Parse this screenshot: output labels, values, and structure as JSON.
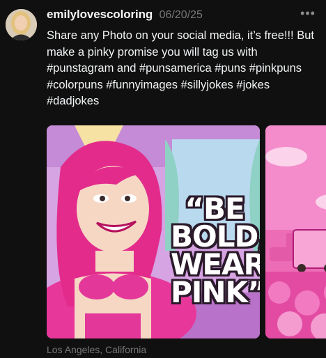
{
  "post": {
    "username": "emilylovescoloring",
    "date": "06/20/25",
    "more_icon": "ellipsis-icon",
    "caption_text": "Share any Photo on your social media, it’s free!!! But make a pinky promise you will tag us with #punstagram and #punsamerica #puns #pinkpuns #colorpuns #funnyimages #sillyjokes #jokes #dadjokes",
    "location": "Los Angeles, California"
  },
  "media": {
    "image1_text_lines": [
      "“BE",
      "BOLD,",
      "WEAR",
      "PINK”"
    ]
  },
  "colors": {
    "background": "#101010",
    "primary_text": "#f3f5f7",
    "secondary_text": "#777777",
    "pink": "#e8379a"
  }
}
